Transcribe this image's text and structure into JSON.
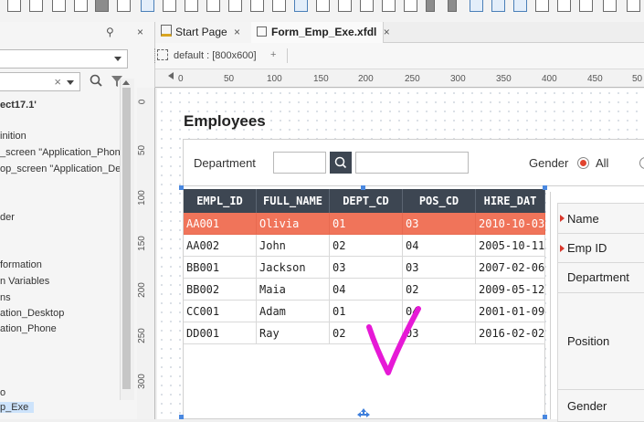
{
  "left_panel": {
    "pin_label": "⚲",
    "close_label": "×",
    "search_clear": "×",
    "project_label": "ect17.1'",
    "tree": [
      "inition",
      "_screen \"Application_Phone",
      "op_screen \"Application_Des",
      "der",
      "formation",
      "n Variables",
      "ns",
      "ation_Desktop",
      "ation_Phone",
      "o",
      "p_Exe"
    ]
  },
  "tabs": [
    {
      "label": "Start Page",
      "close": "×"
    },
    {
      "label": "Form_Emp_Exe.xfdl",
      "close": "×"
    }
  ],
  "screen_bar": {
    "label": "default : [800x600]",
    "add": "+"
  },
  "ruler_h": [
    "0",
    "50",
    "100",
    "150",
    "200",
    "250",
    "300",
    "350",
    "400",
    "450",
    "50"
  ],
  "ruler_v": [
    "0",
    "50",
    "100",
    "150",
    "200",
    "250",
    "300"
  ],
  "form": {
    "title": "Employees",
    "department_label": "Department",
    "gender_label": "Gender",
    "gender_all": "All"
  },
  "grid": {
    "columns": [
      "EMPL_ID",
      "FULL_NAME",
      "DEPT_CD",
      "POS_CD",
      "HIRE_DAT"
    ],
    "rows": [
      [
        "AA001",
        "Olivia",
        "01",
        "03",
        "2010-10-03"
      ],
      [
        "AA002",
        "John",
        "02",
        "04",
        "2005-10-11"
      ],
      [
        "BB001",
        "Jackson",
        "03",
        "03",
        "2007-02-06"
      ],
      [
        "BB002",
        "Maia",
        "04",
        "02",
        "2009-05-12"
      ],
      [
        "CC001",
        "Adam",
        "01",
        "04",
        "2001-01-09"
      ],
      [
        "DD001",
        "Ray",
        "02",
        "03",
        "2016-02-02"
      ]
    ],
    "selected_row": 0
  },
  "detail": {
    "fields": [
      "Name",
      "Emp ID",
      "Department",
      "Position",
      "Gender"
    ]
  },
  "colors": {
    "grid_header": "#3d4652",
    "selected_row": "#f0745a",
    "annotation_stroke": "#e619d6",
    "required_marker": "#d9382c"
  }
}
